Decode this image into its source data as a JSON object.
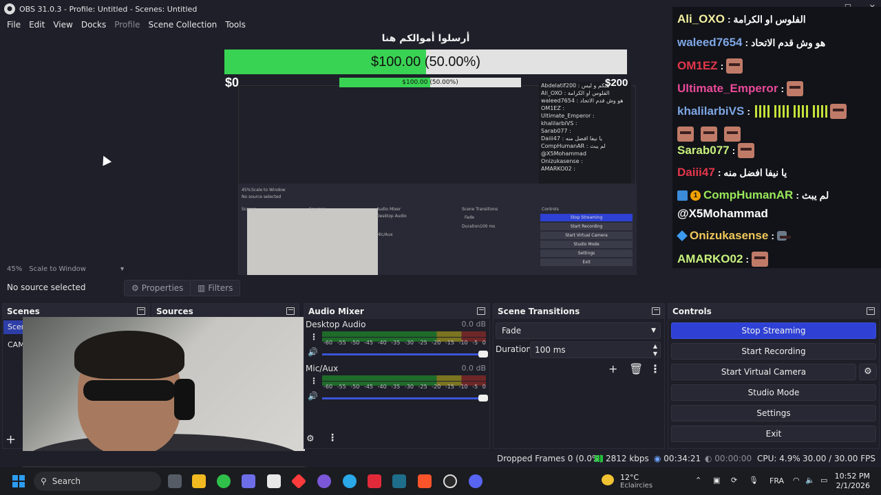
{
  "window": {
    "title": "OBS 31.0.3 - Profile: Untitled - Scenes: Untitled",
    "controls": {
      "minimize": "—",
      "maximize": "☐",
      "close": "✕"
    }
  },
  "menu": [
    "File",
    "Edit",
    "View",
    "Docks",
    "Profile",
    "Scene Collection",
    "Tools"
  ],
  "overlay": {
    "donation_title": "أرسلوا أموالكم هنا",
    "donation_text": "$100.00 (50.00%)",
    "donation_fraction": 0.5,
    "donation_min": "$0",
    "donation_max": "$200"
  },
  "nested_preview": {
    "donation_text": "$100.00 (50.00%)",
    "chat": [
      "Abdelatif200 : منكم و ليس",
      "Ali_OXO : الفلوس او الكرامة",
      "waleed7654 : هو وش قدم الاتحاد",
      "OM1EZ :",
      "Ultimate_Emperor :",
      "khalilarbiVS :",
      "Sarab077 :",
      "Daiii47 : يا نيفا افضل منه",
      "CompHumanAR : لم يبث",
      "@X5Mohammad",
      "Onizukasense :",
      "AMARKO02 :"
    ],
    "controls": [
      "Stop Streaming",
      "Start Recording",
      "Start Virtual Camera",
      "Studio Mode",
      "Settings",
      "Exit"
    ],
    "labels": {
      "no_source": "No source selected",
      "scenes": "Scenes",
      "sources": "Sources",
      "mixer": "Audio Mixer",
      "transitions": "Scene Transitions",
      "controls": "Controls",
      "desktop": "Desktop Audio",
      "mic": "Mic/Aux",
      "fade": "Fade",
      "duration": "Duration",
      "duration_value": "100 ms",
      "zoom": "45%",
      "scale": "Scale to Window"
    }
  },
  "chat": [
    {
      "user": "Ali_OXO",
      "color": "#f3f0a0",
      "msg": ": الفلوس او الكرامة",
      "emotes": []
    },
    {
      "user": "waleed7654",
      "color": "#7fa7e6",
      "msg": ": هو وش قدم الاتحاد",
      "emotes": []
    },
    {
      "user": "OM1EZ",
      "color": "#e4364b",
      "msg": ":",
      "emotes": [
        "face"
      ]
    },
    {
      "user": "Ultimate_Emperor",
      "color": "#e94a9a",
      "msg": ":",
      "emotes": [
        "face"
      ]
    },
    {
      "user": "khalilarbiVS",
      "color": "#7fa7e6",
      "msg": ":",
      "emotes": [
        "bars",
        "bars",
        "bars",
        "bars",
        "face"
      ]
    },
    {
      "user": "Sarab077",
      "color": "#c9f27e",
      "msg": ":",
      "emotes": [
        "face"
      ]
    },
    {
      "user": "Daiii47",
      "color": "#e4364b",
      "msg": ": يا نيفا افضل منه",
      "emotes": []
    },
    {
      "user": "CompHumanAR",
      "color": "#9ae85a",
      "msg": ": لم يبث",
      "emotes": []
    },
    {
      "user": "@X5Mohammad",
      "color": "#ffffff",
      "msg": "",
      "emotes": []
    },
    {
      "user": "Onizukasense",
      "color": "#f0c85a",
      "msg": ":",
      "emotes": [
        "small"
      ]
    },
    {
      "user": "AMARKO02",
      "color": "#c9f27e",
      "msg": ":",
      "emotes": [
        "face"
      ]
    }
  ],
  "preview_footer": {
    "zoom": "45%",
    "scale_mode": "Scale to Window"
  },
  "source_toolbar": {
    "no_source": "No source selected",
    "properties": "Properties",
    "filters": "Filters"
  },
  "docks": {
    "scenes": {
      "title": "Scenes",
      "items": [
        "Scene",
        "CAM"
      ]
    },
    "sources": {
      "title": "Sources"
    },
    "mixer": {
      "title": "Audio Mixer",
      "tracks": [
        {
          "name": "Desktop Audio",
          "db": "0.0 dB"
        },
        {
          "name": "Mic/Aux",
          "db": "0.0 dB"
        }
      ],
      "scale": [
        "-60",
        "-55",
        "-50",
        "-45",
        "-40",
        "-35",
        "-30",
        "-25",
        "-20",
        "-15",
        "-10",
        "-5",
        "0"
      ]
    },
    "transitions": {
      "title": "Scene Transitions",
      "type": "Fade",
      "duration_label": "Duration",
      "duration_value": "100 ms"
    },
    "controls": {
      "title": "Controls",
      "buttons": [
        "Stop Streaming",
        "Start Recording",
        "Start Virtual Camera",
        "Studio Mode",
        "Settings",
        "Exit"
      ]
    }
  },
  "status": {
    "dropped": "Dropped Frames 0 (0.0%)",
    "bitrate": "2812 kbps",
    "stream_time": "00:34:21",
    "record_time": "00:00:00",
    "cpu": "CPU: 4.9%",
    "fps": "30.00 / 30.00 FPS"
  },
  "taskbar": {
    "search": "Search",
    "weather_temp": "12°C",
    "weather_desc": "Eclaircies",
    "lang": "FRA",
    "time": "10:52 PM",
    "date": "2/1/2026"
  }
}
